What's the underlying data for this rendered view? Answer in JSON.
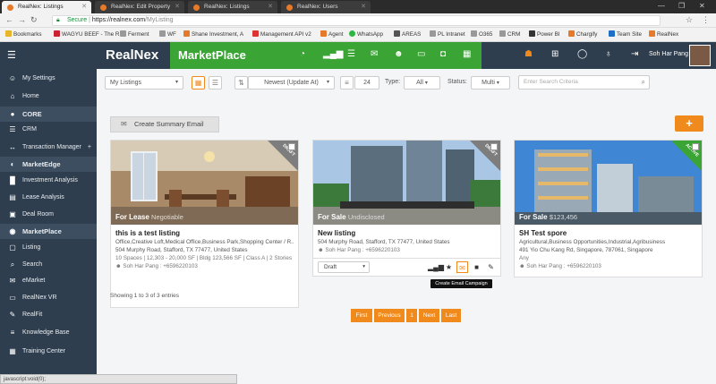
{
  "browser": {
    "tabs": [
      {
        "label": "RealNex: Listings",
        "active": true
      },
      {
        "label": "RealNex: Edit Property",
        "active": false
      },
      {
        "label": "RealNex: Listings",
        "active": false
      },
      {
        "label": "RealNex: Users",
        "active": false
      }
    ],
    "url_secure": "Secure",
    "url_host": "https://realnex.com",
    "url_path": "/MyListing",
    "bookmarks": [
      "Bookmarks",
      "WAGYU BEEF - The R",
      "Ferment",
      "WF",
      "Shane Investment, A",
      "Management API v2",
      "Agent",
      "WhatsApp",
      "AREAS",
      "PL Intranet",
      "O365",
      "CRM",
      "Power BI",
      "Chargify",
      "Team Site",
      "RealNex"
    ]
  },
  "header": {
    "brand": "RealNex",
    "module": "MarketPlace",
    "user": "Soh Har Pang"
  },
  "sidebar": {
    "items": [
      {
        "label": "My Settings",
        "icon": "user-icon",
        "glyph": "☺",
        "section": false
      },
      {
        "label": "Home",
        "icon": "home-icon",
        "glyph": "⌂",
        "section": false
      },
      {
        "label": "CORE",
        "icon": "core-icon",
        "glyph": "●",
        "section": true
      },
      {
        "label": "CRM",
        "icon": "crm-icon",
        "glyph": "☰",
        "section": false
      },
      {
        "label": "Transaction Manager",
        "icon": "transaction-icon",
        "glyph": "↔",
        "section": false,
        "plus": "+"
      },
      {
        "label": "MarketEdge",
        "icon": "marketedge-icon",
        "glyph": "◐",
        "section": true
      },
      {
        "label": "Investment Analysis",
        "icon": "investment-icon",
        "glyph": "█",
        "section": false
      },
      {
        "label": "Lease Analysis",
        "icon": "lease-icon",
        "glyph": "▤",
        "section": false
      },
      {
        "label": "Deal Room",
        "icon": "deal-room-icon",
        "glyph": "▣",
        "section": false
      },
      {
        "label": "MarketPlace",
        "icon": "marketplace-icon",
        "glyph": "◉",
        "section": true
      },
      {
        "label": "Listing",
        "icon": "listing-icon",
        "glyph": "▢",
        "section": false
      },
      {
        "label": "Search",
        "icon": "search-icon",
        "glyph": "⌕",
        "section": false
      },
      {
        "label": "eMarket",
        "icon": "emarket-icon",
        "glyph": "✉",
        "section": false
      },
      {
        "label": "RealNex VR",
        "icon": "vr-icon",
        "glyph": "▭",
        "section": false
      },
      {
        "label": "RealFit",
        "icon": "realfit-icon",
        "glyph": "✎",
        "section": false
      },
      {
        "label": "Knowledge Base",
        "icon": "knowledge-icon",
        "glyph": "≡",
        "section": false
      },
      {
        "label": "Training Center",
        "icon": "training-icon",
        "glyph": "▦",
        "section": false
      }
    ]
  },
  "toolbar": {
    "listing_filter": "My Listings",
    "sort": "Newest (Update At)",
    "page_size": "24",
    "type_label": "Type:",
    "type_value": "All",
    "status_label": "Status:",
    "status_value": "Multi",
    "search_placeholder": "Enter Search Criteria"
  },
  "actions": {
    "summary_email": "Create Summary Email",
    "add": "+"
  },
  "listings": [
    {
      "deal": "For Lease",
      "price": "Negotiable",
      "badge": "DRAFT",
      "title": "this is a test listing",
      "types": "Office,Creative Loft,Medical Office,Business Park,Shopping Center / R...",
      "address": "504 Murphy Road, Stafford, TX 77477, United States",
      "details": "10 Spaces | 12,303 - 20,000 SF | Bldg 123,566 SF | Class A | 2 Stories",
      "agent": "Soh Har Pang : +6596220103"
    },
    {
      "deal": "For Sale",
      "price": "Undisclosed",
      "badge": "DRAFT",
      "title": "New listing",
      "types": "",
      "address": "504 Murphy Road, Stafford, TX 77477, United States",
      "details": "",
      "agent": "Soh Har Pang : +6596220103"
    },
    {
      "deal": "For Sale",
      "price": "$123,456",
      "badge": "ACTIVE",
      "title": "SH Test spore",
      "types": "Agricultural,Business Opportunities,Industrial,Agribusiness",
      "address": "491 Yio Chu Kang Rd, Singapore, 787061, Singapore",
      "details": "Any",
      "agent": "Soh Har Pang : +6596220103"
    }
  ],
  "card_actions": {
    "status": "Draft",
    "tooltip": "Create Email Campaign"
  },
  "footer": {
    "entries": "Showing 1 to 3 of 3 entries",
    "pager": [
      "First",
      "Previous",
      "1",
      "Next",
      "Last"
    ],
    "status_bar": "javascript:void(0);"
  },
  "colors": {
    "accent": "#f08a1c",
    "brand_green": "#3aa535",
    "nav_dark": "#2f3e4e"
  }
}
